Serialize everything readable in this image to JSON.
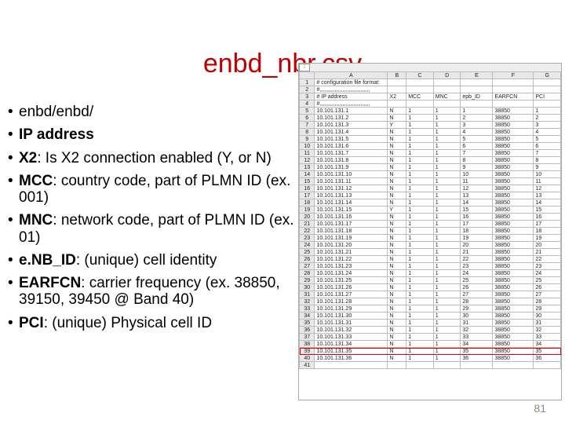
{
  "slide": {
    "title": "enbd_nbr.csv",
    "page_number": "81"
  },
  "bullets": [
    {
      "bold": "",
      "text": "enbd/enbd/"
    },
    {
      "bold": "IP address",
      "text": ""
    },
    {
      "bold": "X2",
      "text": ": Is X2 connection enabled (Y, or N)"
    },
    {
      "bold": "MCC",
      "text": ": country code, part of PLMN ID (ex. 001)"
    },
    {
      "bold": "MNC",
      "text": ": network code, part of PLMN ID (ex. 01)"
    },
    {
      "bold": "e.NB_ID",
      "text": ": (unique) cell identity"
    },
    {
      "bold": "EARFCN",
      "text": ": carrier frequency (ex. 38850, 39150, 39450 @ Band 40)"
    },
    {
      "bold": "PCI",
      "text": ": (unique) Physical cell ID"
    }
  ],
  "spreadsheet": {
    "tabs": [
      "1"
    ],
    "columns": [
      "",
      "A",
      "B",
      "C",
      "D",
      "E",
      "F",
      "G"
    ],
    "header_row_index": "3",
    "headers": [
      "# IP address",
      "X2",
      "MCC",
      "MNC",
      "epb_ID",
      "EARFCN",
      "PCI"
    ],
    "title_cell": "# configuration file format:",
    "highlight_row": "39",
    "rows": [
      {
        "n": "1",
        "a": "# configuration file format:",
        "b": "",
        "c": "",
        "d": "",
        "e": "",
        "f": "",
        "g": ""
      },
      {
        "n": "2",
        "a": "#,,,,,,,,,,,,,,,,,,,,,,,,,,,,,,,,,",
        "b": "",
        "c": "",
        "d": "",
        "e": "",
        "f": "",
        "g": ""
      },
      {
        "n": "3",
        "a": "# IP address",
        "b": "X2",
        "c": "MCC",
        "d": "MNC",
        "e": "epb_ID",
        "f": "EARFCN",
        "g": "PCI"
      },
      {
        "n": "4",
        "a": "#,,,,,,,,,,,,,,,,,,,,,,,,,,,,,,,,,",
        "b": "",
        "c": "",
        "d": "",
        "e": "",
        "f": "",
        "g": ""
      },
      {
        "n": "5",
        "a": "10.101.131.1",
        "b": "N",
        "c": "1",
        "d": "1",
        "e": "1",
        "f": "38850",
        "g": "1"
      },
      {
        "n": "6",
        "a": "10.101.131.2",
        "b": "N",
        "c": "1",
        "d": "1",
        "e": "2",
        "f": "38850",
        "g": "2"
      },
      {
        "n": "7",
        "a": "10.101.131.3",
        "b": "Y",
        "c": "1",
        "d": "1",
        "e": "3",
        "f": "38850",
        "g": "3"
      },
      {
        "n": "8",
        "a": "10.101.131.4",
        "b": "N",
        "c": "1",
        "d": "1",
        "e": "4",
        "f": "38850",
        "g": "4"
      },
      {
        "n": "9",
        "a": "10.101.131.5",
        "b": "N",
        "c": "1",
        "d": "1",
        "e": "5",
        "f": "38850",
        "g": "5"
      },
      {
        "n": "10",
        "a": "10.101.131.6",
        "b": "N",
        "c": "1",
        "d": "1",
        "e": "6",
        "f": "38850",
        "g": "6"
      },
      {
        "n": "11",
        "a": "10.101.131.7",
        "b": "N",
        "c": "1",
        "d": "1",
        "e": "7",
        "f": "38850",
        "g": "7"
      },
      {
        "n": "12",
        "a": "10.101.131.8",
        "b": "N",
        "c": "1",
        "d": "1",
        "e": "8",
        "f": "38850",
        "g": "8"
      },
      {
        "n": "13",
        "a": "10.101.131.9",
        "b": "N",
        "c": "1",
        "d": "1",
        "e": "9",
        "f": "38850",
        "g": "9"
      },
      {
        "n": "14",
        "a": "10.101.131.10",
        "b": "N",
        "c": "1",
        "d": "1",
        "e": "10",
        "f": "38850",
        "g": "10"
      },
      {
        "n": "15",
        "a": "10.101.131.11",
        "b": "N",
        "c": "1",
        "d": "1",
        "e": "11",
        "f": "38850",
        "g": "11"
      },
      {
        "n": "16",
        "a": "10.101.131.12",
        "b": "N",
        "c": "1",
        "d": "1",
        "e": "12",
        "f": "38850",
        "g": "12"
      },
      {
        "n": "17",
        "a": "10.101.131.13",
        "b": "N",
        "c": "1",
        "d": "1",
        "e": "13",
        "f": "38850",
        "g": "13"
      },
      {
        "n": "18",
        "a": "10.101.131.14",
        "b": "N",
        "c": "1",
        "d": "1",
        "e": "14",
        "f": "38850",
        "g": "14"
      },
      {
        "n": "19",
        "a": "10.101.131.15",
        "b": "Y",
        "c": "1",
        "d": "1",
        "e": "15",
        "f": "38850",
        "g": "15"
      },
      {
        "n": "20",
        "a": "10.101.131.16",
        "b": "N",
        "c": "1",
        "d": "1",
        "e": "16",
        "f": "38850",
        "g": "16"
      },
      {
        "n": "21",
        "a": "10.101.131.17",
        "b": "N",
        "c": "1",
        "d": "1",
        "e": "17",
        "f": "38850",
        "g": "17"
      },
      {
        "n": "22",
        "a": "10.101.131.18",
        "b": "N",
        "c": "1",
        "d": "1",
        "e": "18",
        "f": "38850",
        "g": "18"
      },
      {
        "n": "23",
        "a": "10.101.131.19",
        "b": "N",
        "c": "1",
        "d": "1",
        "e": "19",
        "f": "38850",
        "g": "19"
      },
      {
        "n": "24",
        "a": "10.101.131.20",
        "b": "N",
        "c": "1",
        "d": "1",
        "e": "20",
        "f": "38850",
        "g": "20"
      },
      {
        "n": "25",
        "a": "10.101.131.21",
        "b": "N",
        "c": "1",
        "d": "1",
        "e": "21",
        "f": "38850",
        "g": "21"
      },
      {
        "n": "26",
        "a": "10.101.131.22",
        "b": "N",
        "c": "1",
        "d": "1",
        "e": "22",
        "f": "38850",
        "g": "22"
      },
      {
        "n": "27",
        "a": "10.101.131.23",
        "b": "N",
        "c": "1",
        "d": "1",
        "e": "23",
        "f": "38850",
        "g": "23"
      },
      {
        "n": "28",
        "a": "10.101.131.24",
        "b": "N",
        "c": "1",
        "d": "1",
        "e": "24",
        "f": "38850",
        "g": "24"
      },
      {
        "n": "29",
        "a": "10.101.131.25",
        "b": "N",
        "c": "1",
        "d": "1",
        "e": "25",
        "f": "38850",
        "g": "25"
      },
      {
        "n": "30",
        "a": "10.101.131.26",
        "b": "N",
        "c": "1",
        "d": "1",
        "e": "26",
        "f": "38850",
        "g": "26"
      },
      {
        "n": "31",
        "a": "10.101.131.27",
        "b": "N",
        "c": "1",
        "d": "1",
        "e": "27",
        "f": "38850",
        "g": "27"
      },
      {
        "n": "32",
        "a": "10.101.131.28",
        "b": "N",
        "c": "1",
        "d": "1",
        "e": "28",
        "f": "38850",
        "g": "28"
      },
      {
        "n": "33",
        "a": "10.101.131.29",
        "b": "N",
        "c": "1",
        "d": "1",
        "e": "29",
        "f": "38850",
        "g": "29"
      },
      {
        "n": "34",
        "a": "10.101.131.30",
        "b": "N",
        "c": "1",
        "d": "1",
        "e": "30",
        "f": "38850",
        "g": "30"
      },
      {
        "n": "35",
        "a": "10.101.131.31",
        "b": "N",
        "c": "1",
        "d": "1",
        "e": "31",
        "f": "38850",
        "g": "31"
      },
      {
        "n": "36",
        "a": "10.101.131.32",
        "b": "N",
        "c": "1",
        "d": "1",
        "e": "32",
        "f": "38850",
        "g": "32"
      },
      {
        "n": "37",
        "a": "10.101.131.33",
        "b": "N",
        "c": "1",
        "d": "1",
        "e": "33",
        "f": "38850",
        "g": "33"
      },
      {
        "n": "38",
        "a": "10.101.131.34",
        "b": "N",
        "c": "1",
        "d": "1",
        "e": "34",
        "f": "38850",
        "g": "34"
      },
      {
        "n": "39",
        "a": "10.101.131.35",
        "b": "N",
        "c": "1",
        "d": "1",
        "e": "35",
        "f": "38850",
        "g": "35"
      },
      {
        "n": "40",
        "a": "10.101.131.36",
        "b": "N",
        "c": "1",
        "d": "1",
        "e": "36",
        "f": "38850",
        "g": "36"
      },
      {
        "n": "41",
        "a": "",
        "b": "",
        "c": "",
        "d": "",
        "e": "",
        "f": "",
        "g": ""
      }
    ]
  }
}
